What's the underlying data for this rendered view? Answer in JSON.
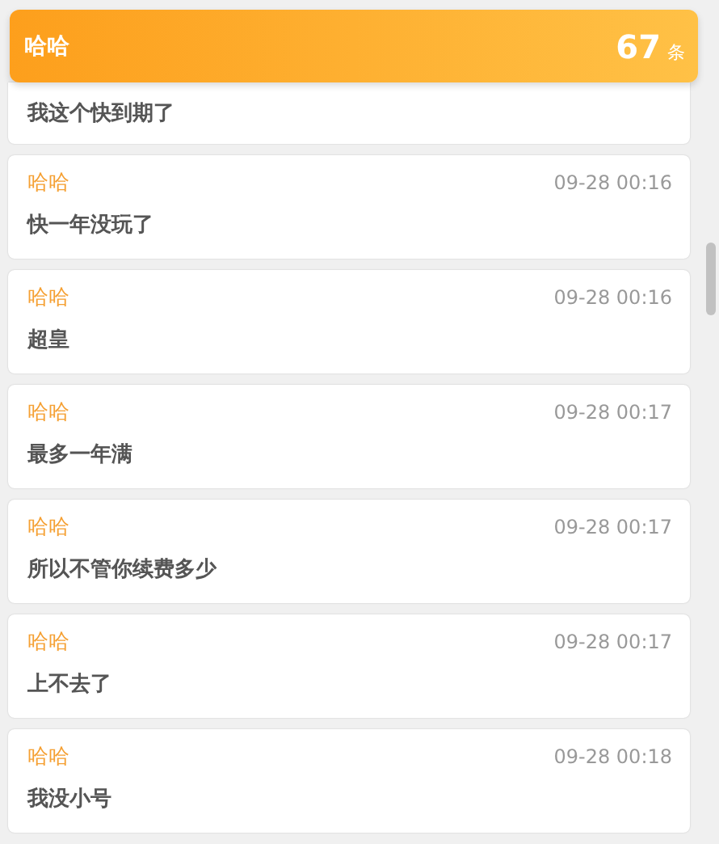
{
  "header": {
    "title": "哈哈",
    "count": "67",
    "unit": "条"
  },
  "messages": [
    {
      "text": "我这个快到期了"
    },
    {
      "name": "哈哈",
      "time": "09-28 00:16",
      "text": "快一年没玩了"
    },
    {
      "name": "哈哈",
      "time": "09-28 00:16",
      "text": "超皇"
    },
    {
      "name": "哈哈",
      "time": "09-28 00:17",
      "text": "最多一年满"
    },
    {
      "name": "哈哈",
      "time": "09-28 00:17",
      "text": "所以不管你续费多少"
    },
    {
      "name": "哈哈",
      "time": "09-28 00:17",
      "text": "上不去了"
    },
    {
      "name": "哈哈",
      "time": "09-28 00:18",
      "text": "我没小号"
    }
  ]
}
